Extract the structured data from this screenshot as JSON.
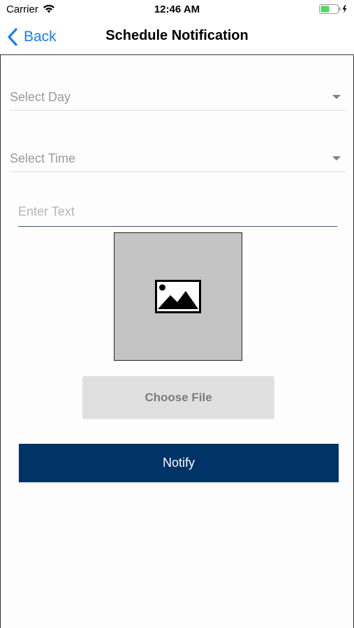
{
  "status_bar": {
    "carrier": "Carrier",
    "time": "12:46 AM",
    "wifi_icon": "wifi-icon",
    "battery_icon": "battery-charging-icon",
    "battery_color": "#4cd964"
  },
  "nav": {
    "back_label": "Back",
    "back_icon": "chevron-left-icon",
    "title": "Schedule Notification",
    "accent_color": "#1a7cf5"
  },
  "form": {
    "select_day": {
      "label": "Select Day",
      "icon": "caret-down-icon"
    },
    "select_time": {
      "label": "Select Time",
      "icon": "caret-down-icon"
    },
    "text_input": {
      "placeholder": "Enter Text",
      "value": ""
    },
    "image_placeholder": {
      "icon": "image-icon"
    },
    "choose_file_label": "Choose File",
    "notify_label": "Notify",
    "notify_color": "#003366"
  }
}
